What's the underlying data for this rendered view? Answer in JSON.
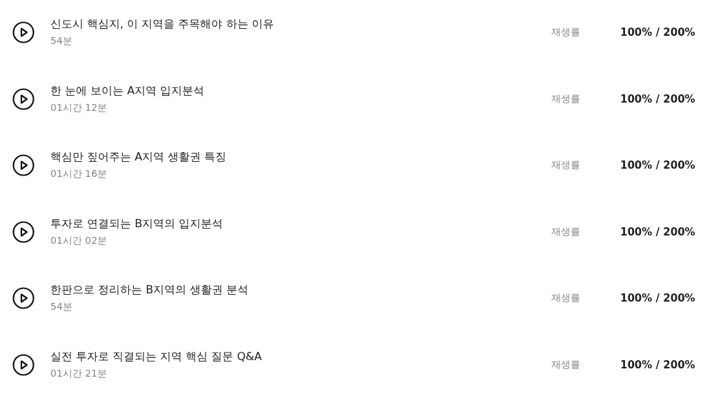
{
  "lessons": [
    {
      "title": "신도시 핵심지, 이 지역을 주목해야 하는 이유",
      "duration": "54분",
      "rate_label": "재생률",
      "rate": "100% / 200%"
    },
    {
      "title": "한 눈에 보이는 A지역 입지분석",
      "duration": "01시간 12분",
      "rate_label": "재생률",
      "rate": "100% / 200%"
    },
    {
      "title": "핵심만 짚어주는 A지역 생활권 특징",
      "duration": "01시간 16분",
      "rate_label": "재생률",
      "rate": "100% / 200%"
    },
    {
      "title": "투자로 연결되는 B지역의 입지분석",
      "duration": "01시간 02분",
      "rate_label": "재생률",
      "rate": "100% / 200%"
    },
    {
      "title": "한판으로 정리하는 B지역의 생활권 분석",
      "duration": "54분",
      "rate_label": "재생률",
      "rate": "100% / 200%"
    },
    {
      "title": "실전 투자로 직결되는 지역 핵심 질문 Q&A",
      "duration": "01시간 21분",
      "rate_label": "재생률",
      "rate": "100% / 200%"
    }
  ]
}
